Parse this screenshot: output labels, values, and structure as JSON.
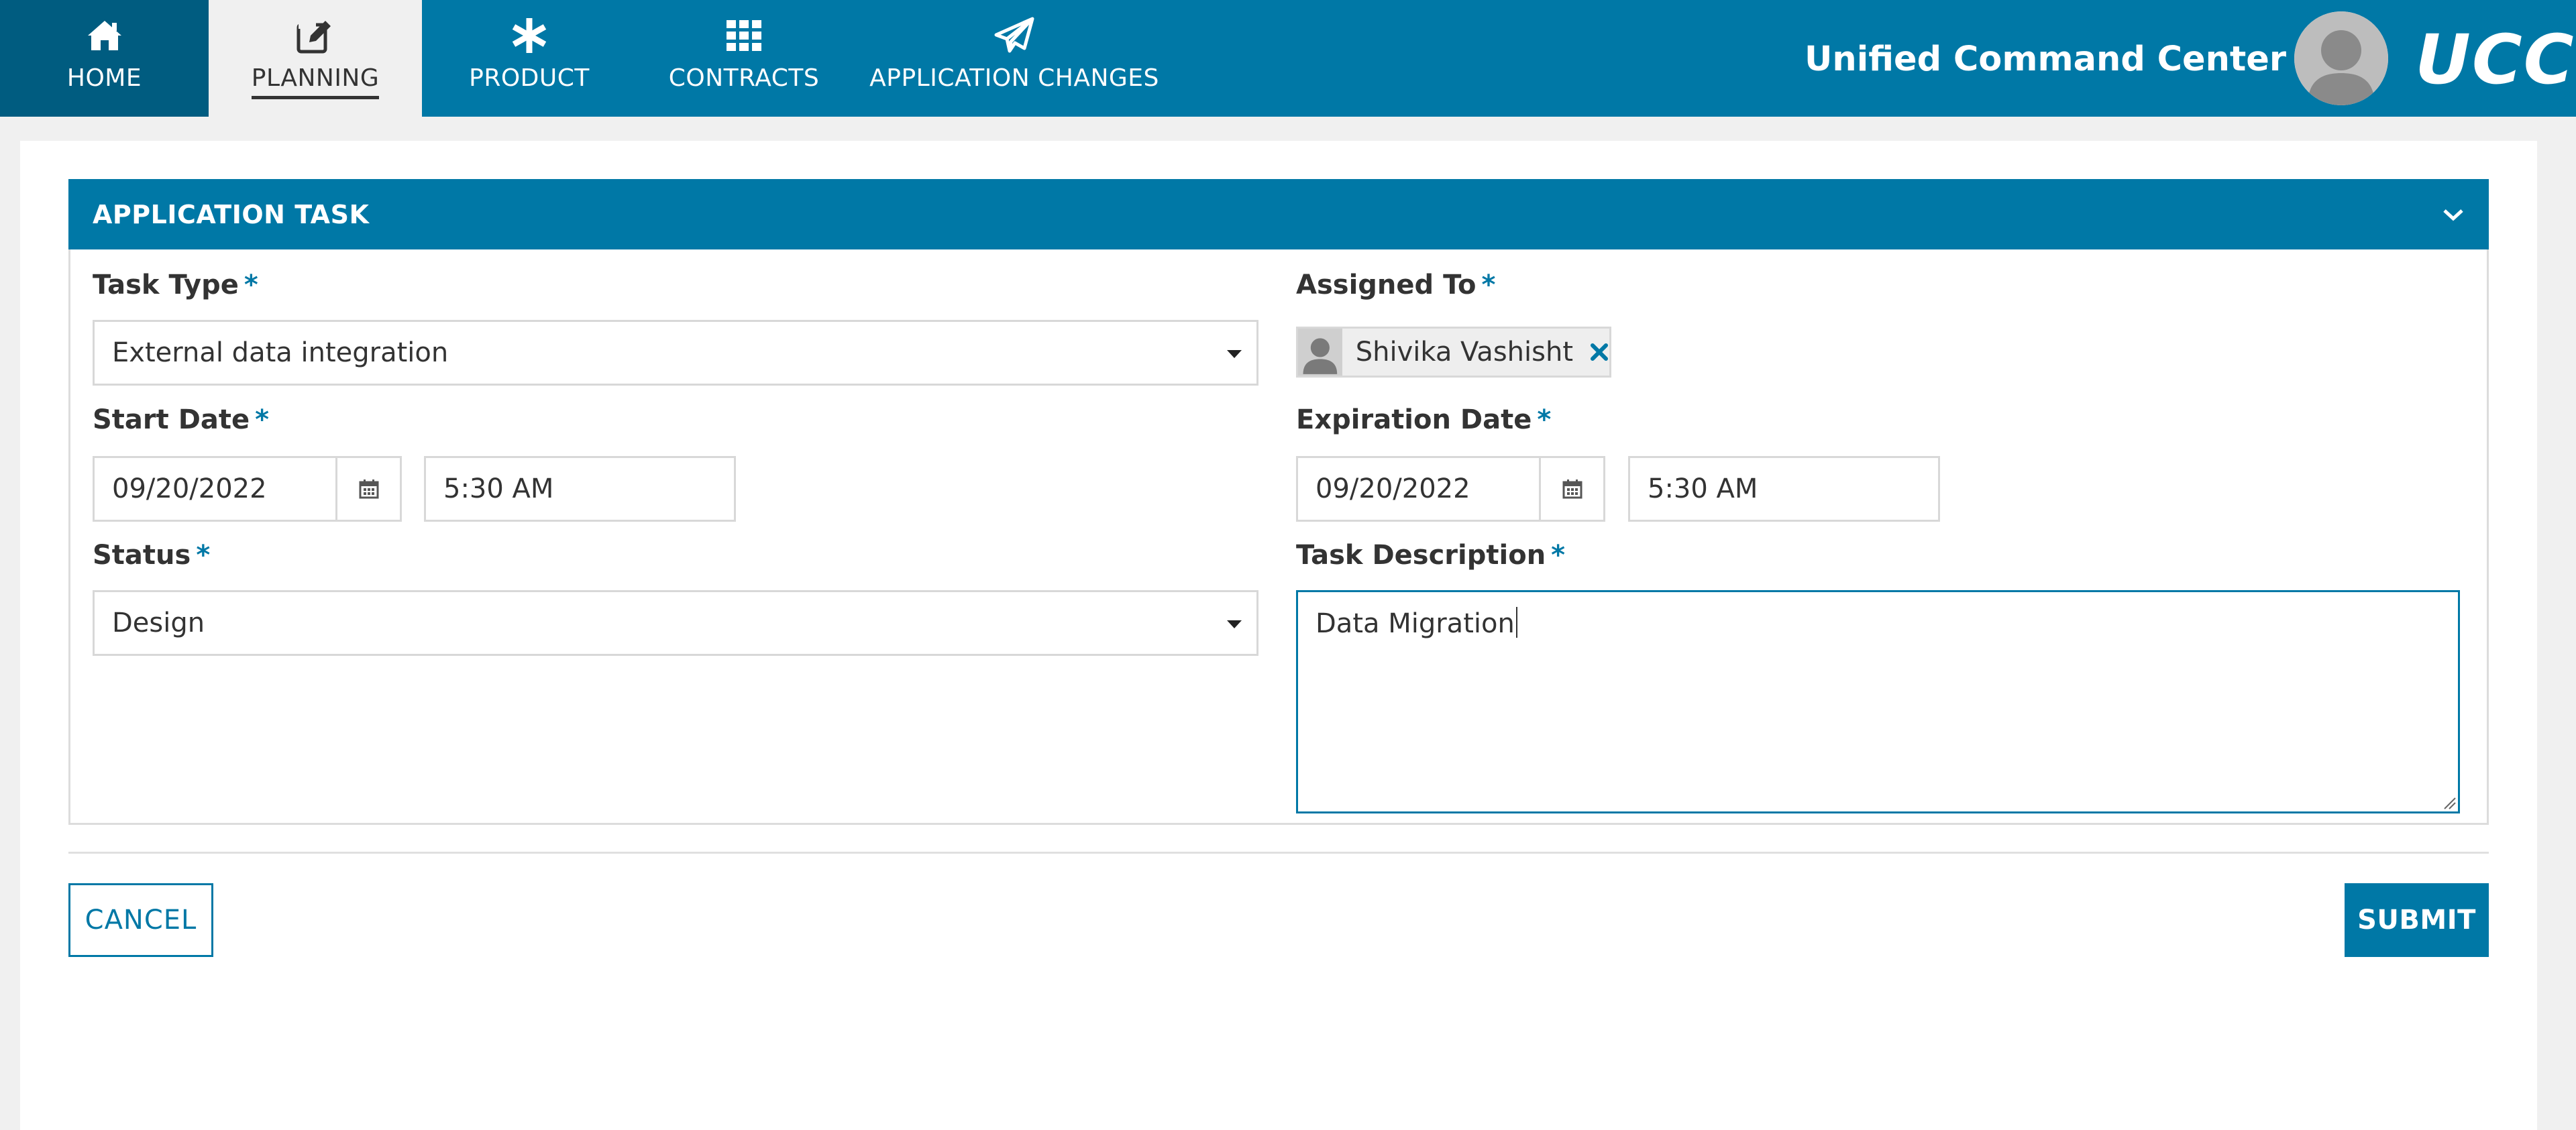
{
  "nav": {
    "items": [
      {
        "label": "HOME",
        "icon": "home-icon"
      },
      {
        "label": "PLANNING",
        "icon": "edit-icon"
      },
      {
        "label": "PRODUCT",
        "icon": "asterisk-icon"
      },
      {
        "label": "CONTRACTS",
        "icon": "grid-icon"
      },
      {
        "label": "APPLICATION CHANGES",
        "icon": "paper-plane-icon"
      }
    ],
    "active": "PLANNING",
    "app_switcher": "Unified Command Center",
    "brand": "UCC"
  },
  "panel": {
    "title": "APPLICATION TASK"
  },
  "form": {
    "task_type": {
      "label": "Task Type",
      "required": "*",
      "value": "External data integration"
    },
    "assigned_to": {
      "label": "Assigned To",
      "required": "*",
      "value": "Shivika Vashisht"
    },
    "start_date": {
      "label": "Start Date",
      "required": "*",
      "date": "09/20/2022",
      "time": "5:30 AM"
    },
    "expiration_date": {
      "label": "Expiration Date",
      "required": "*",
      "date": "09/20/2022",
      "time": "5:30 AM"
    },
    "status": {
      "label": "Status",
      "required": "*",
      "value": "Design"
    },
    "task_description": {
      "label": "Task Description",
      "required": "*",
      "value": "Data Migration"
    }
  },
  "actions": {
    "cancel": "CANCEL",
    "submit": "SUBMIT"
  },
  "colors": {
    "primary": "#0078a6",
    "home_bg": "#005c80",
    "page_bg": "#f0f0f0"
  }
}
